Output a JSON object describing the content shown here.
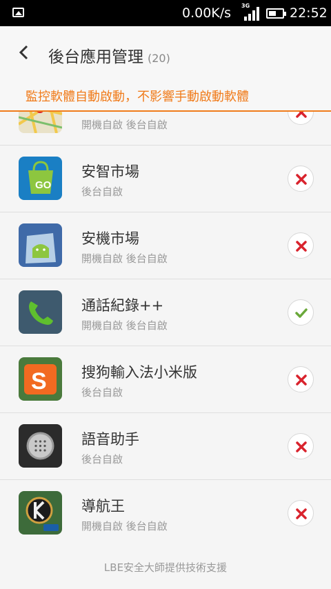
{
  "status_bar": {
    "speed": "0.00K/s",
    "network_tag": "3G",
    "time": "22:52"
  },
  "header": {
    "title": "後台應用管理",
    "count": "(20)"
  },
  "notice": "監控軟體自動啟動，不影響手動啟動軟體",
  "apps": [
    {
      "name": "",
      "status": "開機自啟 後台自啟",
      "allowed": false,
      "icon": "map-icon"
    },
    {
      "name": "安智市場",
      "status": "後台自啟",
      "allowed": false,
      "icon": "gfan-market-icon"
    },
    {
      "name": "安機市場",
      "status": "開機自啟 後台自啟",
      "allowed": false,
      "icon": "android-market-icon"
    },
    {
      "name": "通話紀錄++",
      "status": "開機自啟 後台自啟",
      "allowed": true,
      "icon": "phone-icon"
    },
    {
      "name": "搜狗輸入法小米版",
      "status": "後台自啟",
      "allowed": false,
      "icon": "sogou-input-icon"
    },
    {
      "name": "語音助手",
      "status": "後台自啟",
      "allowed": false,
      "icon": "voice-assistant-icon"
    },
    {
      "name": "導航王",
      "status": "開機自啟 後台自啟",
      "allowed": false,
      "icon": "navigation-king-icon"
    }
  ],
  "footer": "LBE安全大師提供技術支援",
  "colors": {
    "accent": "#f07b1a",
    "deny": "#d9232d",
    "allow": "#6aa83a"
  }
}
